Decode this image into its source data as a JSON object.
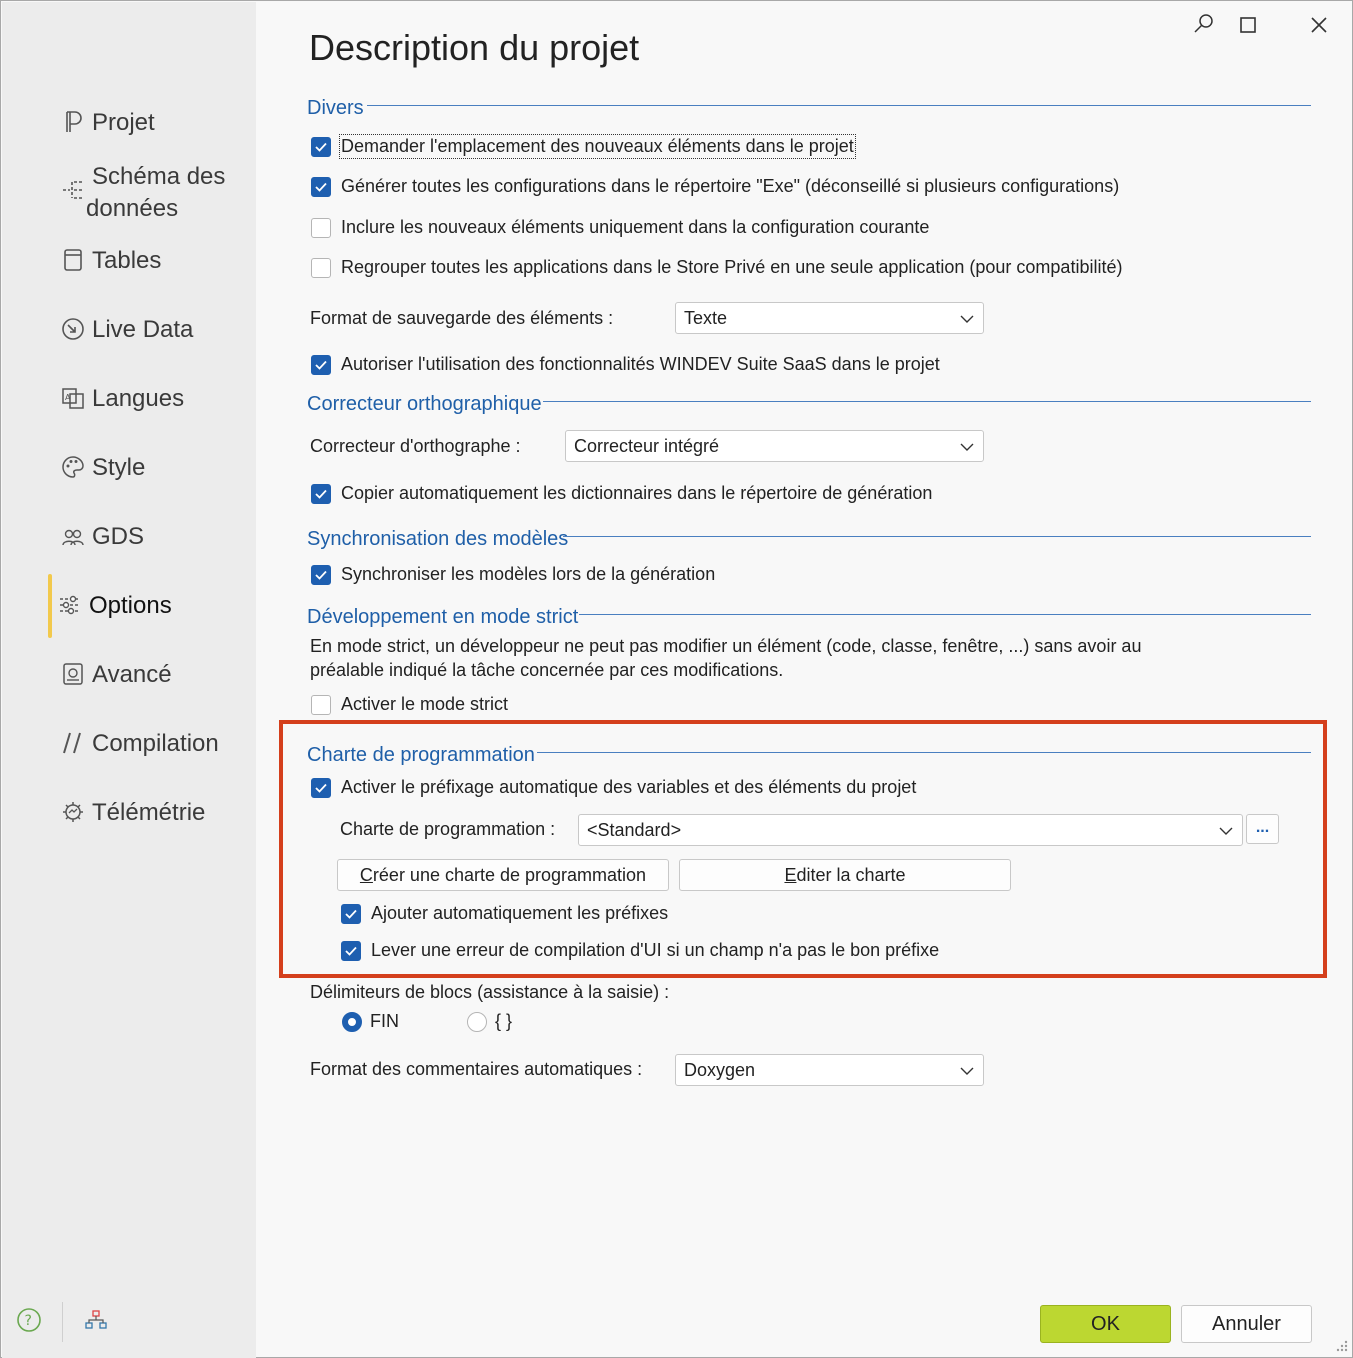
{
  "window": {
    "title": "Description du projet"
  },
  "sidebar": {
    "items": [
      {
        "label": "Projet",
        "icon": "project-icon"
      },
      {
        "label": "Schéma des données",
        "icon": "schema-icon"
      },
      {
        "label": "Tables",
        "icon": "tables-icon"
      },
      {
        "label": "Live Data",
        "icon": "live-data-icon"
      },
      {
        "label": "Langues",
        "icon": "languages-icon"
      },
      {
        "label": "Style",
        "icon": "palette-icon"
      },
      {
        "label": "GDS",
        "icon": "team-icon"
      },
      {
        "label": "Options",
        "icon": "options-icon",
        "active": true
      },
      {
        "label": "Avancé",
        "icon": "advanced-icon"
      },
      {
        "label": "Compilation",
        "icon": "compilation-icon"
      },
      {
        "label": "Télémétrie",
        "icon": "telemetry-icon"
      }
    ],
    "schema_label_line1": "Schéma des",
    "schema_label_line2": "données"
  },
  "sections": {
    "divers": {
      "title": "Divers",
      "options": [
        {
          "label": "Demander l'emplacement des nouveaux éléments dans le projet",
          "checked": true
        },
        {
          "label": "Générer toutes les configurations dans le répertoire \"Exe\" (déconseillé si plusieurs configurations)",
          "checked": true
        },
        {
          "label": "Inclure les nouveaux éléments uniquement dans la configuration courante",
          "checked": false
        },
        {
          "label": "Regrouper toutes les applications dans le Store Privé en une seule application (pour compatibilité)",
          "checked": false
        }
      ],
      "save_format_label": "Format de sauvegarde des éléments :",
      "save_format_value": "Texte",
      "saas_label": "Autoriser l'utilisation des fonctionnalités WINDEV Suite SaaS dans le projet",
      "saas_checked": true
    },
    "spell": {
      "title": "Correcteur orthographique",
      "checker_label": "Correcteur d'orthographe :",
      "checker_value": "Correcteur intégré",
      "copy_dict_label": "Copier automatiquement les dictionnaires dans le répertoire de génération",
      "copy_dict_checked": true
    },
    "sync": {
      "title": "Synchronisation des modèles",
      "sync_label": "Synchroniser les modèles lors de la génération",
      "sync_checked": true
    },
    "strict": {
      "title": "Développement en mode strict",
      "desc_line1": "En mode strict, un développeur ne peut pas modifier un élément (code, classe, fenêtre, ...) sans avoir au",
      "desc_line2": "préalable indiqué la tâche concernée par ces modifications.",
      "activate_label": "Activer le mode strict",
      "activate_checked": false
    },
    "charter": {
      "title": "Charte de programmation",
      "prefix_label": "Activer le préfixage automatique des variables et des éléments du projet",
      "prefix_checked": true,
      "charter_label": "Charte de programmation :",
      "charter_value": "<Standard>",
      "more_button": "...",
      "create_button_u": "C",
      "create_button_rest": "réer une charte de programmation",
      "edit_button_u": "E",
      "edit_button_rest": "diter la charte",
      "auto_prefix_label": "Ajouter automatiquement les préfixes",
      "auto_prefix_checked": true,
      "ui_error_label": "Lever une erreur de compilation d'UI si un champ n'a pas le bon préfixe",
      "ui_error_checked": true
    },
    "blocks": {
      "label": "Délimiteurs de blocs (assistance à la saisie) :",
      "option_fin": "FIN",
      "option_braces": "{ }",
      "selected": "FIN"
    },
    "comments": {
      "label": "Format des commentaires automatiques :",
      "value": "Doxygen"
    }
  },
  "footer": {
    "ok": "OK",
    "cancel": "Annuler"
  },
  "colors": {
    "accent_blue": "#1f5fa8",
    "checkbox_blue": "#1e5fb0",
    "ok_green": "#bcd731",
    "highlight_red": "#d43f1c",
    "active_indicator": "#f2c94c"
  }
}
